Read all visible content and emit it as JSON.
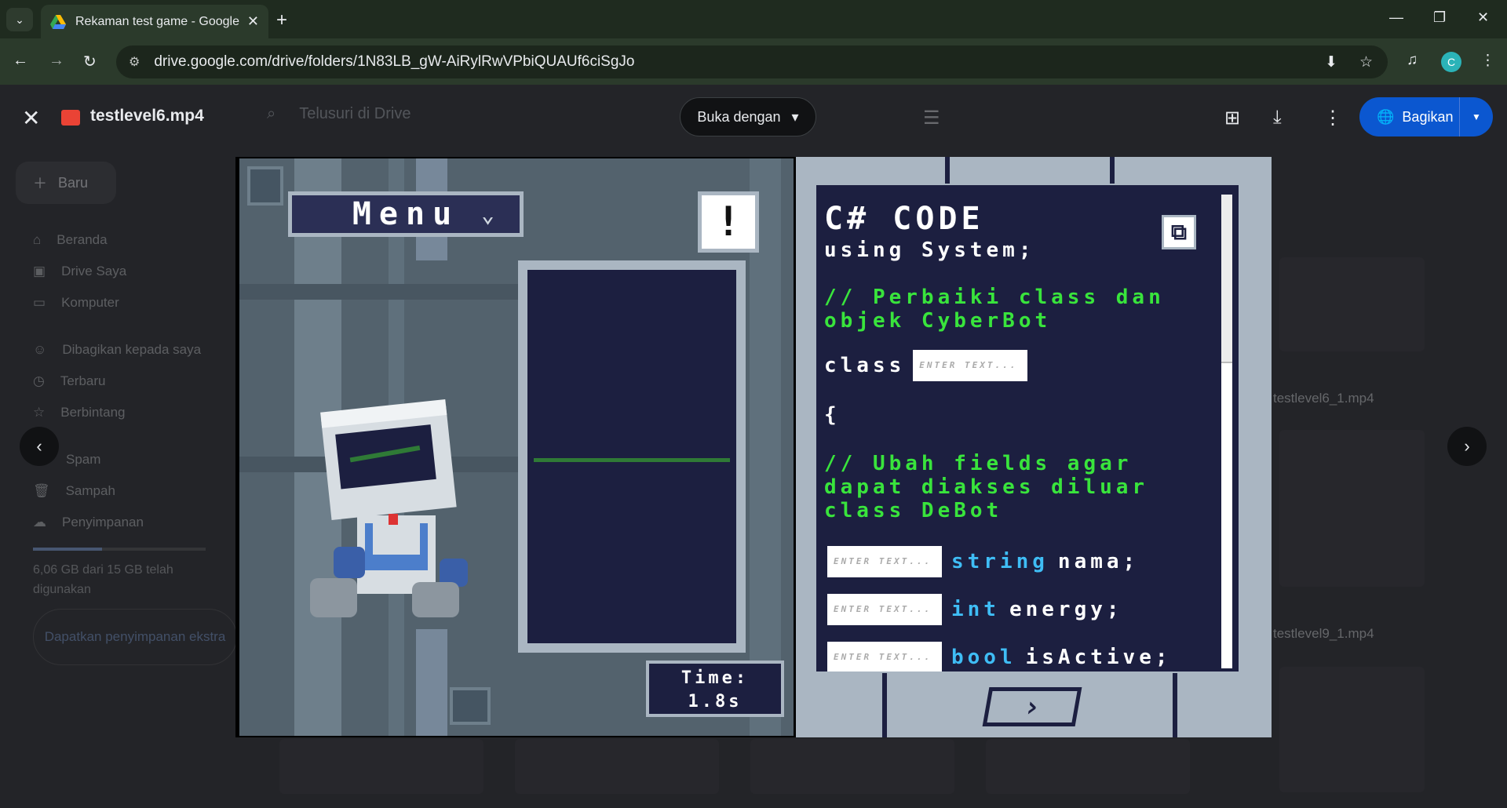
{
  "browser": {
    "tab_title": "Rekaman test game - Google D",
    "url": "drive.google.com/drive/folders/1N83LB_gW-AiRylRwVPbiQUAUf6ciSgJo",
    "profile_initial": "C"
  },
  "drive": {
    "new_label": "Baru",
    "search_placeholder": "Telusuri di Drive",
    "nav": [
      "Beranda",
      "Drive Saya",
      "Komputer",
      "Dibagikan kepada saya",
      "Terbaru",
      "Berbintang",
      "Spam",
      "Sampah",
      "Penyimpanan"
    ],
    "storage_text": "6,06 GB dari 15 GB telah digunakan",
    "storage_fraction": 0.4,
    "storage_button": "Dapatkan penyimpanan ekstra",
    "file_names": [
      "testlevel6_1.mp4",
      "testlevel9_1.mp4"
    ]
  },
  "viewer": {
    "file_name": "testlevel6.mp4",
    "open_with": "Buka dengan",
    "share": "Bagikan"
  },
  "game": {
    "menu_label": "Menu",
    "alert_glyph": "!",
    "timer_label": "Time:",
    "timer_value": "1.8s",
    "code_title": "C# CODE",
    "using_line": "using System;",
    "comment1_a": "// Perbaiki class dan",
    "comment1_b": "objek CyberBot",
    "class_kw": "class",
    "brace": "{",
    "comment2_a": "// Ubah fields agar",
    "comment2_b": "dapat diakses diluar",
    "comment2_c": "class DeBot",
    "field_placeholder": "ENTER TEXT...",
    "fields": [
      {
        "type": "string",
        "name": "nama;"
      },
      {
        "type": "int",
        "name": "energy;"
      },
      {
        "type": "bool",
        "name": "isActive;"
      }
    ]
  }
}
